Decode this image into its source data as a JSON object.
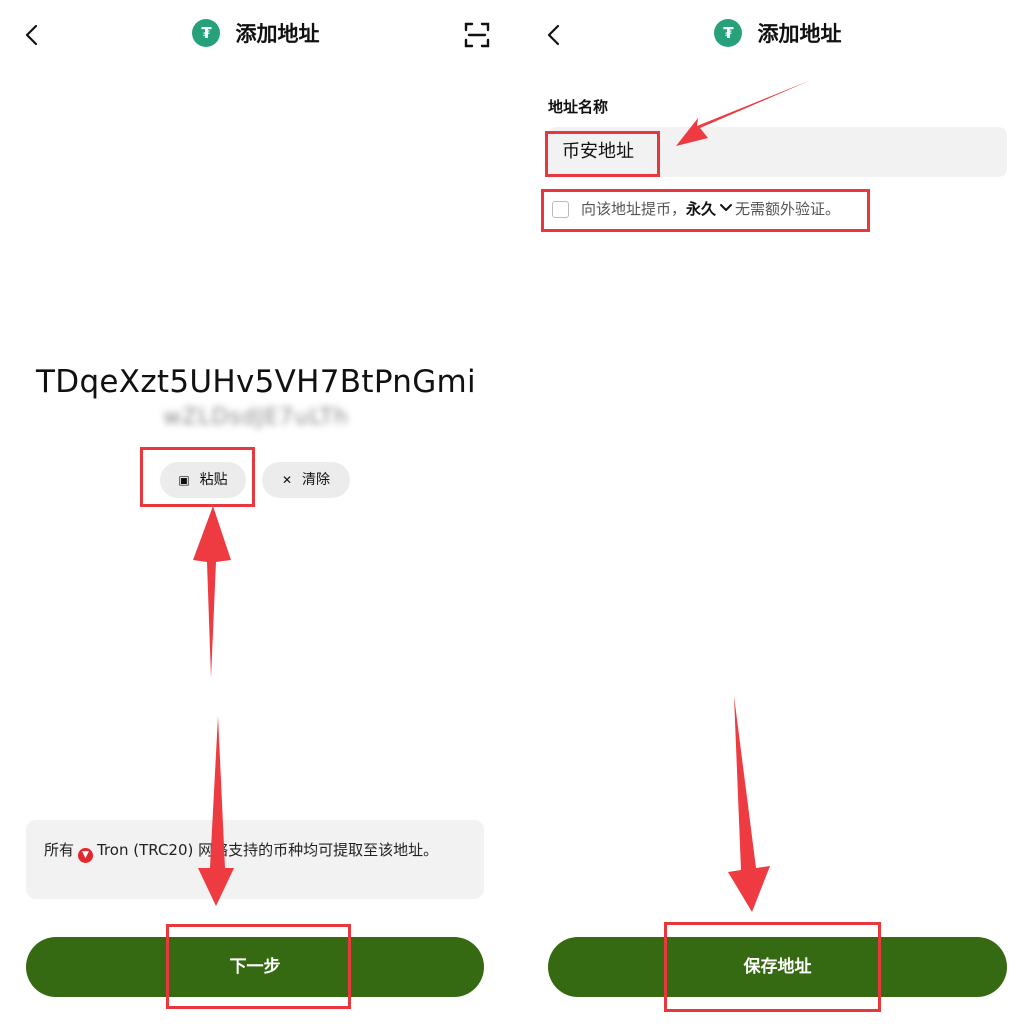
{
  "left": {
    "header": {
      "title": "添加地址",
      "back_icon": "chevron-left-icon",
      "scan_icon": "scan-icon"
    },
    "address": {
      "line1": "TDqeXzt5UHv5VH7BtPnGmi",
      "line2": "wZLDsdJE7uLTh"
    },
    "paste_label": "粘贴",
    "clear_label": "清除",
    "info": {
      "prefix": "所有",
      "network": "Tron (TRC20)",
      "suffix": "网络支持的币种均可提取至该地址。"
    },
    "next_label": "下一步"
  },
  "right": {
    "header": {
      "title": "添加地址"
    },
    "name_label": "地址名称",
    "name_value": "币安地址",
    "whitelist": {
      "text_before": "向该地址提币，",
      "period": "永久",
      "text_after": "无需额外验证。",
      "checked": false
    },
    "save_label": "保存地址"
  },
  "colors": {
    "primary": "#356a12",
    "highlight": "#e8373d",
    "usdt": "#26a17b",
    "tron": "#e0282d"
  }
}
